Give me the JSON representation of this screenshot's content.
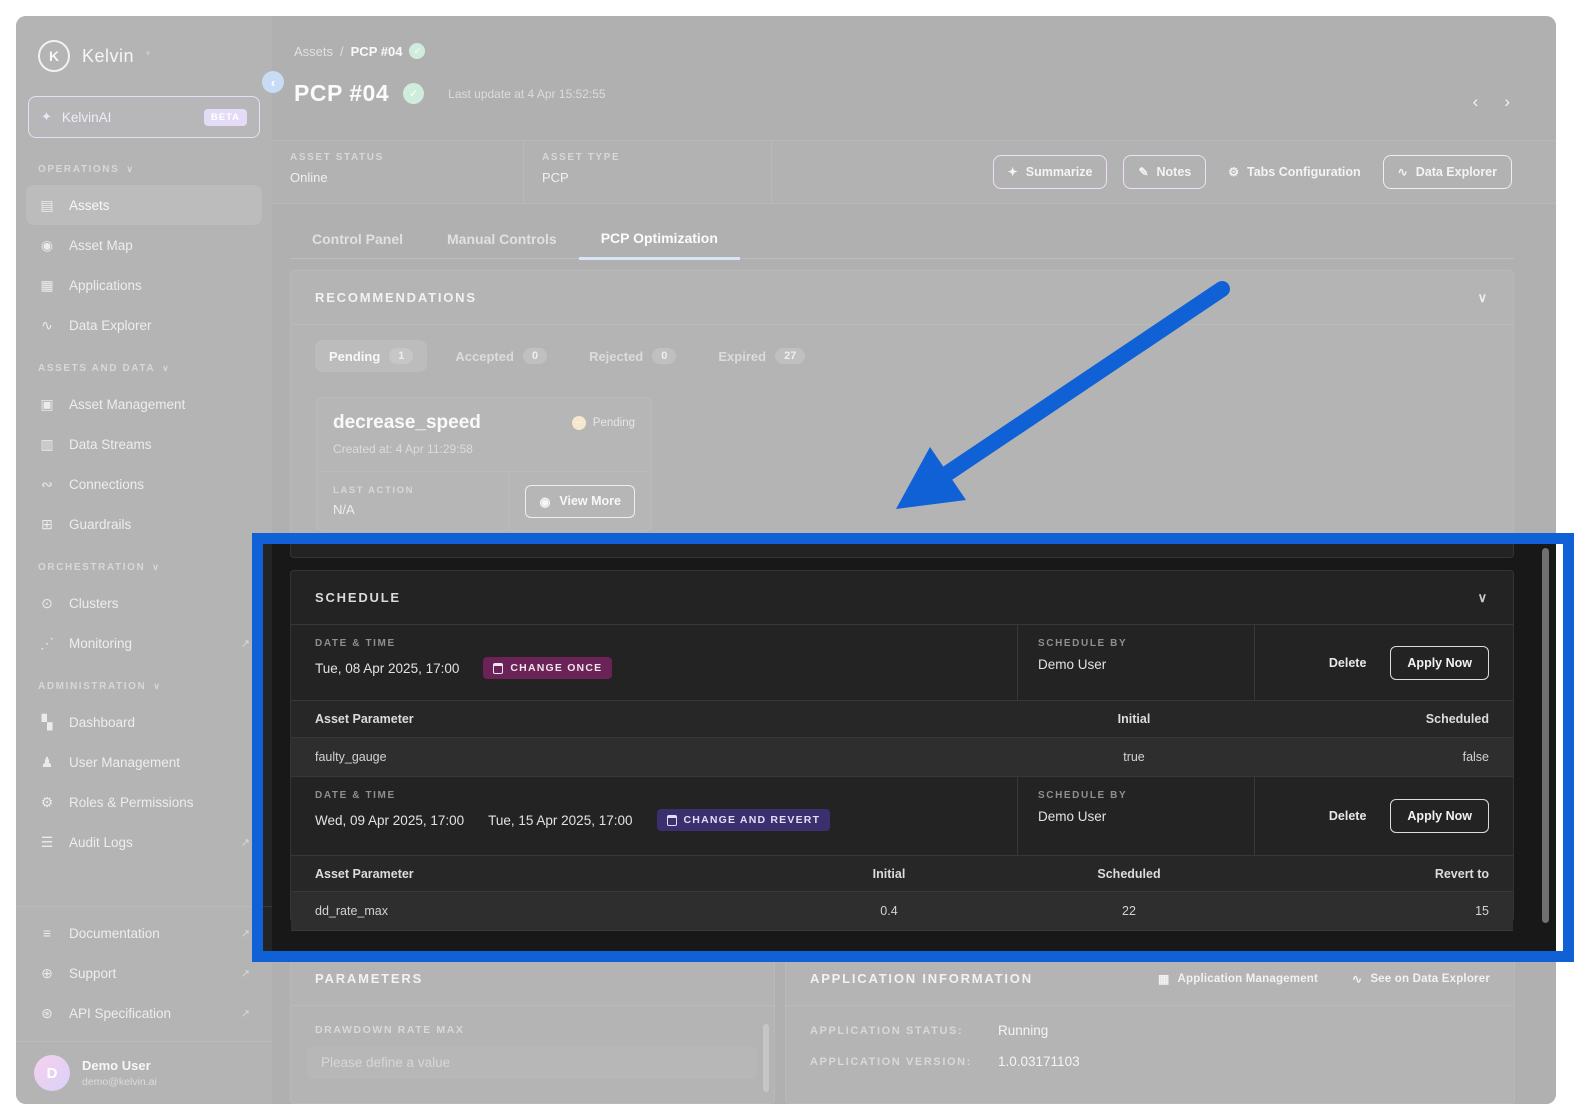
{
  "icons": {
    "collapse": "‹",
    "chevron_down": "∨",
    "chevron_left": "‹",
    "chevron_right": "›",
    "sparkle": "✦",
    "assets": "▤",
    "asset_map": "◉",
    "applications": "▦",
    "data_explorer": "∿",
    "asset_management": "▣",
    "data_streams": "▥",
    "connections": "∾",
    "guardrails": "⊞",
    "clusters": "⊙",
    "monitoring": "⋰",
    "dashboard": "▚",
    "user_management": "♟",
    "roles": "⚙",
    "audit_logs": "☰",
    "documentation": "≡",
    "support": "⊕",
    "api_spec": "⊛",
    "external": "↗",
    "check": "✓",
    "eye": "◉",
    "notes": "✎",
    "gear": "⚙",
    "grid": "▦",
    "wave": "∿",
    "dots": "⋯",
    "logo_initial": "K"
  },
  "sidebar": {
    "logo_text": "Kelvin",
    "logo_mark": "°",
    "ai": {
      "label": "KelvinAI",
      "badge": "BETA"
    },
    "groups": [
      {
        "title": "OPERATIONS",
        "items": [
          {
            "label": "Assets"
          },
          {
            "label": "Asset Map"
          },
          {
            "label": "Applications"
          },
          {
            "label": "Data Explorer"
          }
        ]
      },
      {
        "title": "ASSETS AND DATA",
        "items": [
          {
            "label": "Asset Management"
          },
          {
            "label": "Data Streams"
          },
          {
            "label": "Connections"
          },
          {
            "label": "Guardrails"
          }
        ]
      },
      {
        "title": "ORCHESTRATION",
        "items": [
          {
            "label": "Clusters"
          },
          {
            "label": "Monitoring"
          }
        ]
      },
      {
        "title": "ADMINISTRATION",
        "items": [
          {
            "label": "Dashboard"
          },
          {
            "label": "User Management"
          },
          {
            "label": "Roles & Permissions"
          },
          {
            "label": "Audit Logs"
          }
        ]
      }
    ],
    "footer_links": [
      {
        "label": "Documentation"
      },
      {
        "label": "Support"
      },
      {
        "label": "API Specification"
      }
    ],
    "user": {
      "initial": "D",
      "name": "Demo User",
      "email": "demo@kelvin.ai"
    }
  },
  "header": {
    "breadcrumb": {
      "root": "Assets",
      "sep": "/",
      "current": "PCP #04"
    },
    "title": "PCP #04",
    "last_update": "Last update at 4 Apr 15:52:55"
  },
  "status_bar": {
    "status_label": "ASSET STATUS",
    "status_value": "Online",
    "type_label": "ASSET TYPE",
    "type_value": "PCP",
    "summarize": "Summarize",
    "notes": "Notes",
    "tabs_config": "Tabs Configuration",
    "data_explorer": "Data Explorer"
  },
  "tabs": [
    {
      "label": "Control Panel"
    },
    {
      "label": "Manual Controls"
    },
    {
      "label": "PCP Optimization"
    }
  ],
  "recommendations": {
    "title": "RECOMMENDATIONS",
    "filters": [
      {
        "label": "Pending",
        "count": "1"
      },
      {
        "label": "Accepted",
        "count": "0"
      },
      {
        "label": "Rejected",
        "count": "0"
      },
      {
        "label": "Expired",
        "count": "27"
      }
    ],
    "card": {
      "name": "decrease_speed",
      "status": "Pending",
      "created": "Created at: 4 Apr 11:29:58",
      "last_action_label": "LAST ACTION",
      "last_action": "N/A",
      "view_more": "View More"
    }
  },
  "schedule": {
    "title": "SCHEDULE",
    "entries": [
      {
        "datetime_label": "DATE & TIME",
        "datetime": "Tue, 08 Apr 2025, 17:00",
        "badge": "CHANGE ONCE",
        "by_label": "SCHEDULE BY",
        "by": "Demo User",
        "delete": "Delete",
        "apply": "Apply Now",
        "table": {
          "headers": [
            "Asset Parameter",
            "Initial",
            "Scheduled"
          ],
          "rows": [
            [
              "faulty_gauge",
              "true",
              "false"
            ]
          ]
        }
      },
      {
        "datetime_label": "DATE & TIME",
        "datetime": "Wed, 09 Apr 2025, 17:00",
        "datetime2": "Tue, 15 Apr 2025, 17:00",
        "badge": "CHANGE AND REVERT",
        "by_label": "SCHEDULE BY",
        "by": "Demo User",
        "delete": "Delete",
        "apply": "Apply Now",
        "table": {
          "headers": [
            "Asset Parameter",
            "Initial",
            "Scheduled",
            "Revert to"
          ],
          "rows": [
            [
              "dd_rate_max",
              "0.4",
              "22",
              "15"
            ]
          ]
        }
      }
    ]
  },
  "parameters": {
    "title": "PARAMETERS",
    "field_label": "DRAWDOWN RATE MAX",
    "placeholder": "Please define a value"
  },
  "app_info": {
    "title": "APPLICATION INFORMATION",
    "link_mgmt": "Application Management",
    "link_explorer": "See on Data Explorer",
    "status_label": "APPLICATION STATUS:",
    "status_value": "Running",
    "version_label": "APPLICATION VERSION:",
    "version_value": "1.0.03171103"
  }
}
